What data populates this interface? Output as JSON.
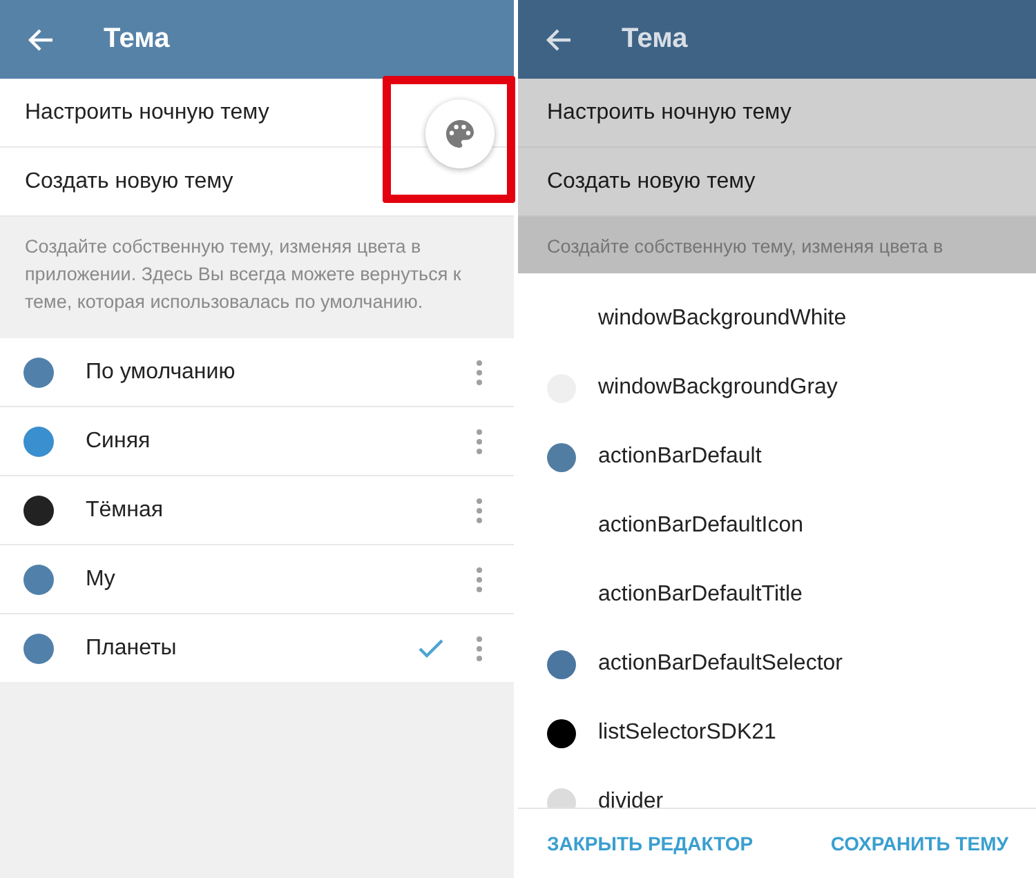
{
  "left": {
    "header": {
      "title": "Тема"
    },
    "menu": [
      {
        "label": "Настроить ночную тему"
      },
      {
        "label": "Создать новую тему"
      }
    ],
    "description": "Создайте собственную тему, изменяя цвета в приложении. Здесь Вы всегда можете вернуться к теме, которая использовалась по умолчанию.",
    "themes": [
      {
        "name": "По умолчанию",
        "color": "#5181aa",
        "selected": false
      },
      {
        "name": "Синяя",
        "color": "#3a8fce",
        "selected": false
      },
      {
        "name": "Тёмная",
        "color": "#222222",
        "selected": false
      },
      {
        "name": "My",
        "color": "#5181aa",
        "selected": false
      },
      {
        "name": "Планеты",
        "color": "#5181aa",
        "selected": true
      }
    ]
  },
  "right": {
    "header": {
      "title": "Тема"
    },
    "menu": [
      {
        "label": "Настроить ночную тему"
      },
      {
        "label": "Создать новую тему"
      }
    ],
    "description": [
      "Создайте собственную тему, изменяя цвета в"
    ],
    "colors": [
      {
        "name": "windowBackgroundWhite",
        "color": "#ffffff"
      },
      {
        "name": "windowBackgroundGray",
        "color": "#efefef"
      },
      {
        "name": "actionBarDefault",
        "color": "#527da3"
      },
      {
        "name": "actionBarDefaultIcon",
        "color": "#ffffff"
      },
      {
        "name": "actionBarDefaultTitle",
        "color": "#ffffff"
      },
      {
        "name": "actionBarDefaultSelector",
        "color": "#4a76a0"
      },
      {
        "name": "listSelectorSDK21",
        "color": "#000000"
      },
      {
        "name": "divider",
        "color": "#dcdcdc"
      }
    ],
    "buttons": [
      "ЗАКРЫТЬ РЕДАКТОР",
      "СОХРАНИТЬ ТЕМУ"
    ]
  }
}
